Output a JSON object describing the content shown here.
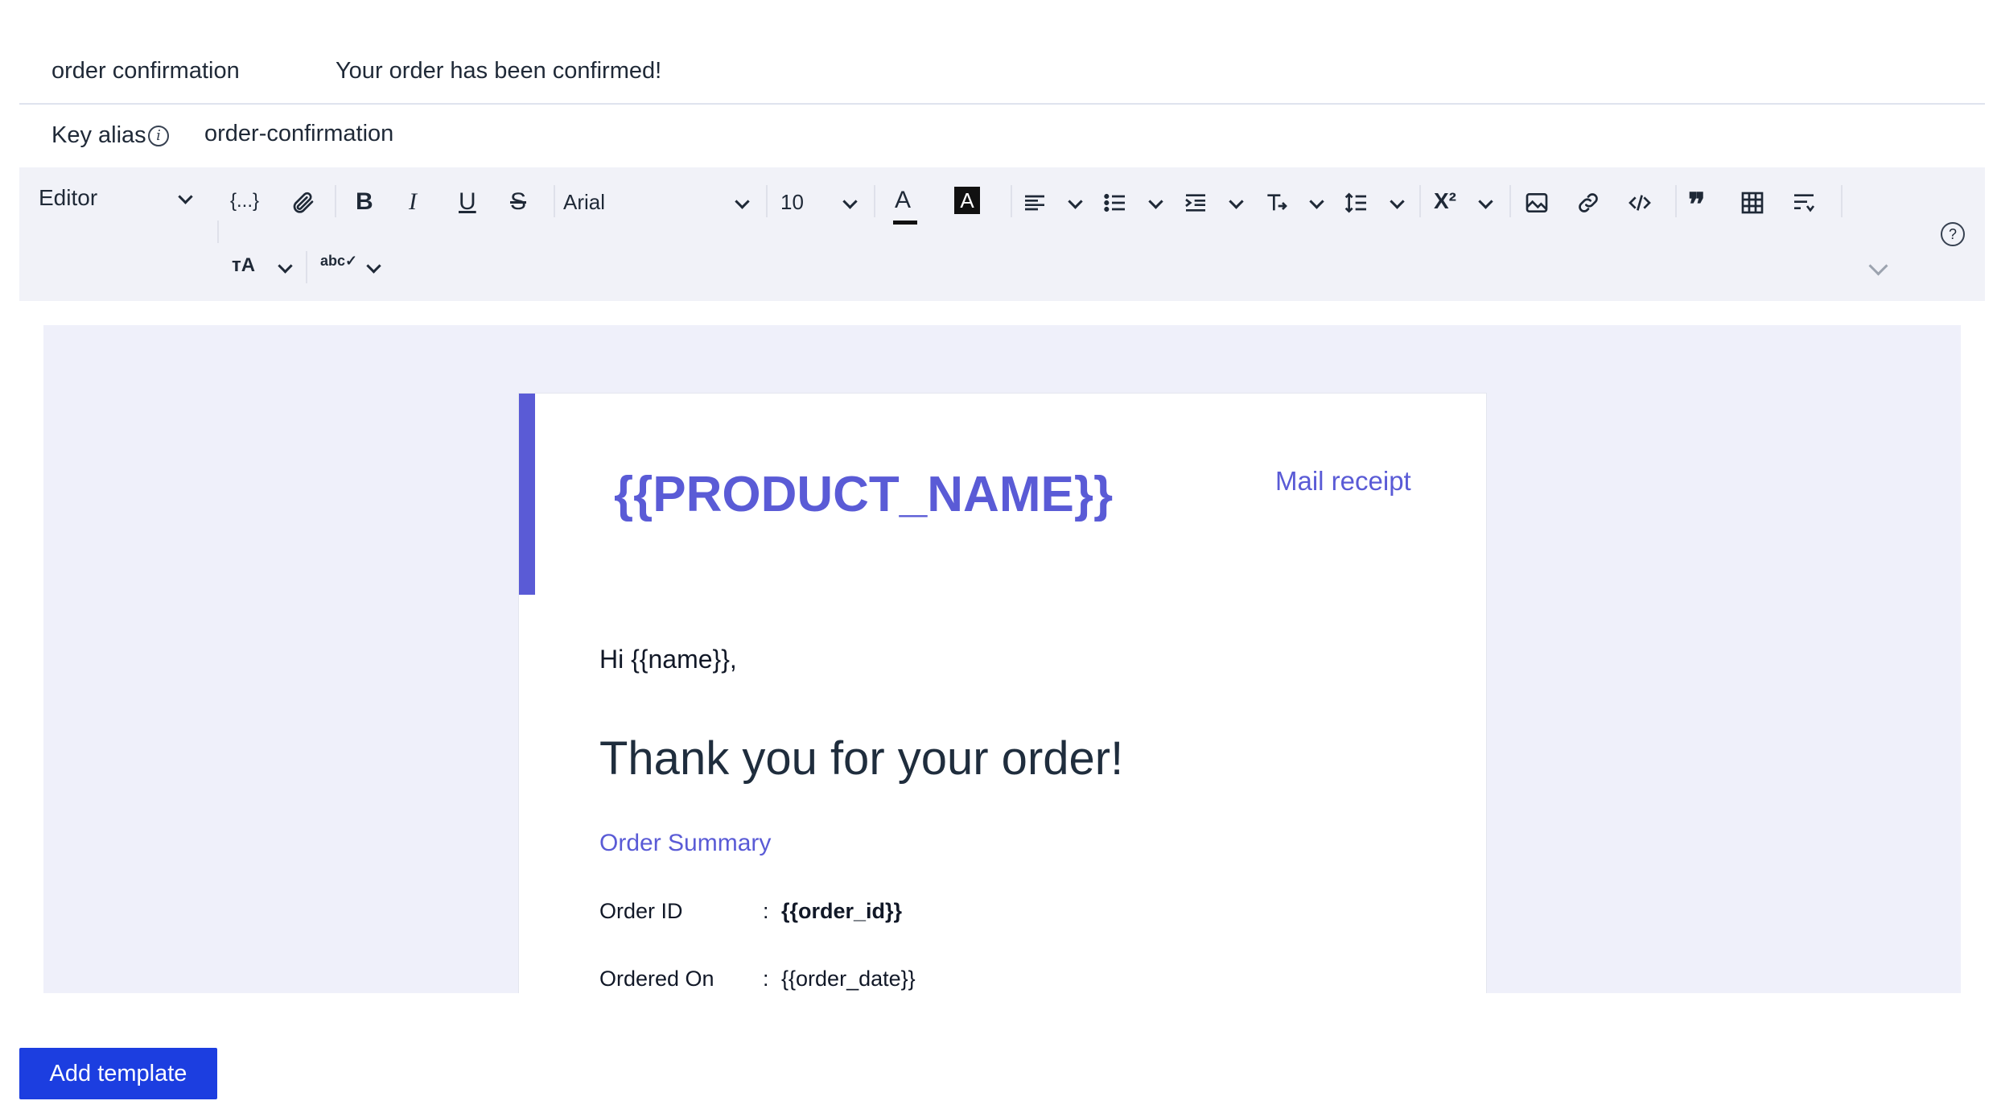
{
  "template": {
    "name": "order confirmation",
    "subject": "Your order has been confirmed!"
  },
  "key_alias": {
    "label": "Key alias",
    "value": "order-confirmation"
  },
  "toolbar": {
    "mode": "Editor",
    "variables_label": "{...}",
    "font": "Arial",
    "font_size": "10"
  },
  "email": {
    "product_name": "{{PRODUCT_NAME}}",
    "mail_receipt": "Mail receipt",
    "greeting": "Hi {{name}},",
    "headline": "Thank you for your order!",
    "summary_title": "Order Summary",
    "fields": [
      {
        "label": "Order ID",
        "sep": ":",
        "value": "{{order_id}}"
      },
      {
        "label": "Ordered On",
        "sep": ":",
        "value": "{{order_date}}"
      }
    ],
    "accent_color": "#5a5bd6"
  },
  "actions": {
    "add_template": "Add template",
    "primary_color": "#1c3ee0"
  }
}
